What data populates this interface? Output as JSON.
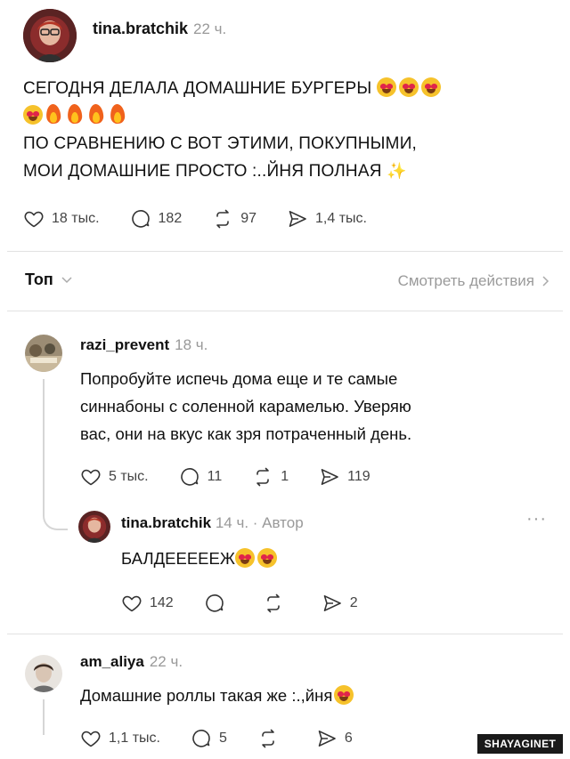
{
  "post": {
    "username": "tina.bratchik",
    "time": "22 ч.",
    "line1": "СЕГОДНЯ ДЕЛАЛА ДОМАШНИЕ БУРГЕРЫ",
    "line3": "ПО СРАВНЕНИЮ С ВОТ ЭТИМИ, ПОКУПНЫМИ,",
    "line4": "МОИ ДОМАШНИЕ ПРОСТО ",
    "line4_censored": ":..",
    "line4_end": "ЙНЯ ПОЛНАЯ",
    "likes": "18 тыс.",
    "comments": "182",
    "reposts": "97",
    "shares": "1,4 тыс."
  },
  "sort": {
    "label": "Топ",
    "activity_link": "Смотреть действия"
  },
  "comment1": {
    "username": "razi_prevent",
    "time": "18 ч.",
    "line1": "Попробуйте испечь дома еще и те самые",
    "line2": "синнабоны с соленной карамелью. Уверяю",
    "line3": "вас, они на вкус как зря потраченный день.",
    "likes": "5 тыс.",
    "comments": "11",
    "reposts": "1",
    "shares": "119"
  },
  "reply1": {
    "username": "tina.bratchik",
    "time": "14 ч. · Автор",
    "text": "БАЛДЕЕЕЕЕЖ",
    "likes": "142",
    "shares": "2"
  },
  "comment2": {
    "username": "am_aliya",
    "time": "22 ч.",
    "text_start": "Домашние роллы такая же ",
    "text_censored": ":.,",
    "text_end": "йня",
    "likes": "1,1 тыс.",
    "comments": "5",
    "shares": "6"
  },
  "watermark": "SHAYAGINET",
  "colors": {
    "text": "#111111",
    "muted": "#999999",
    "divider": "#e2e2e2",
    "emoji_face": "#f6c22b",
    "fire": "#f0621c"
  }
}
